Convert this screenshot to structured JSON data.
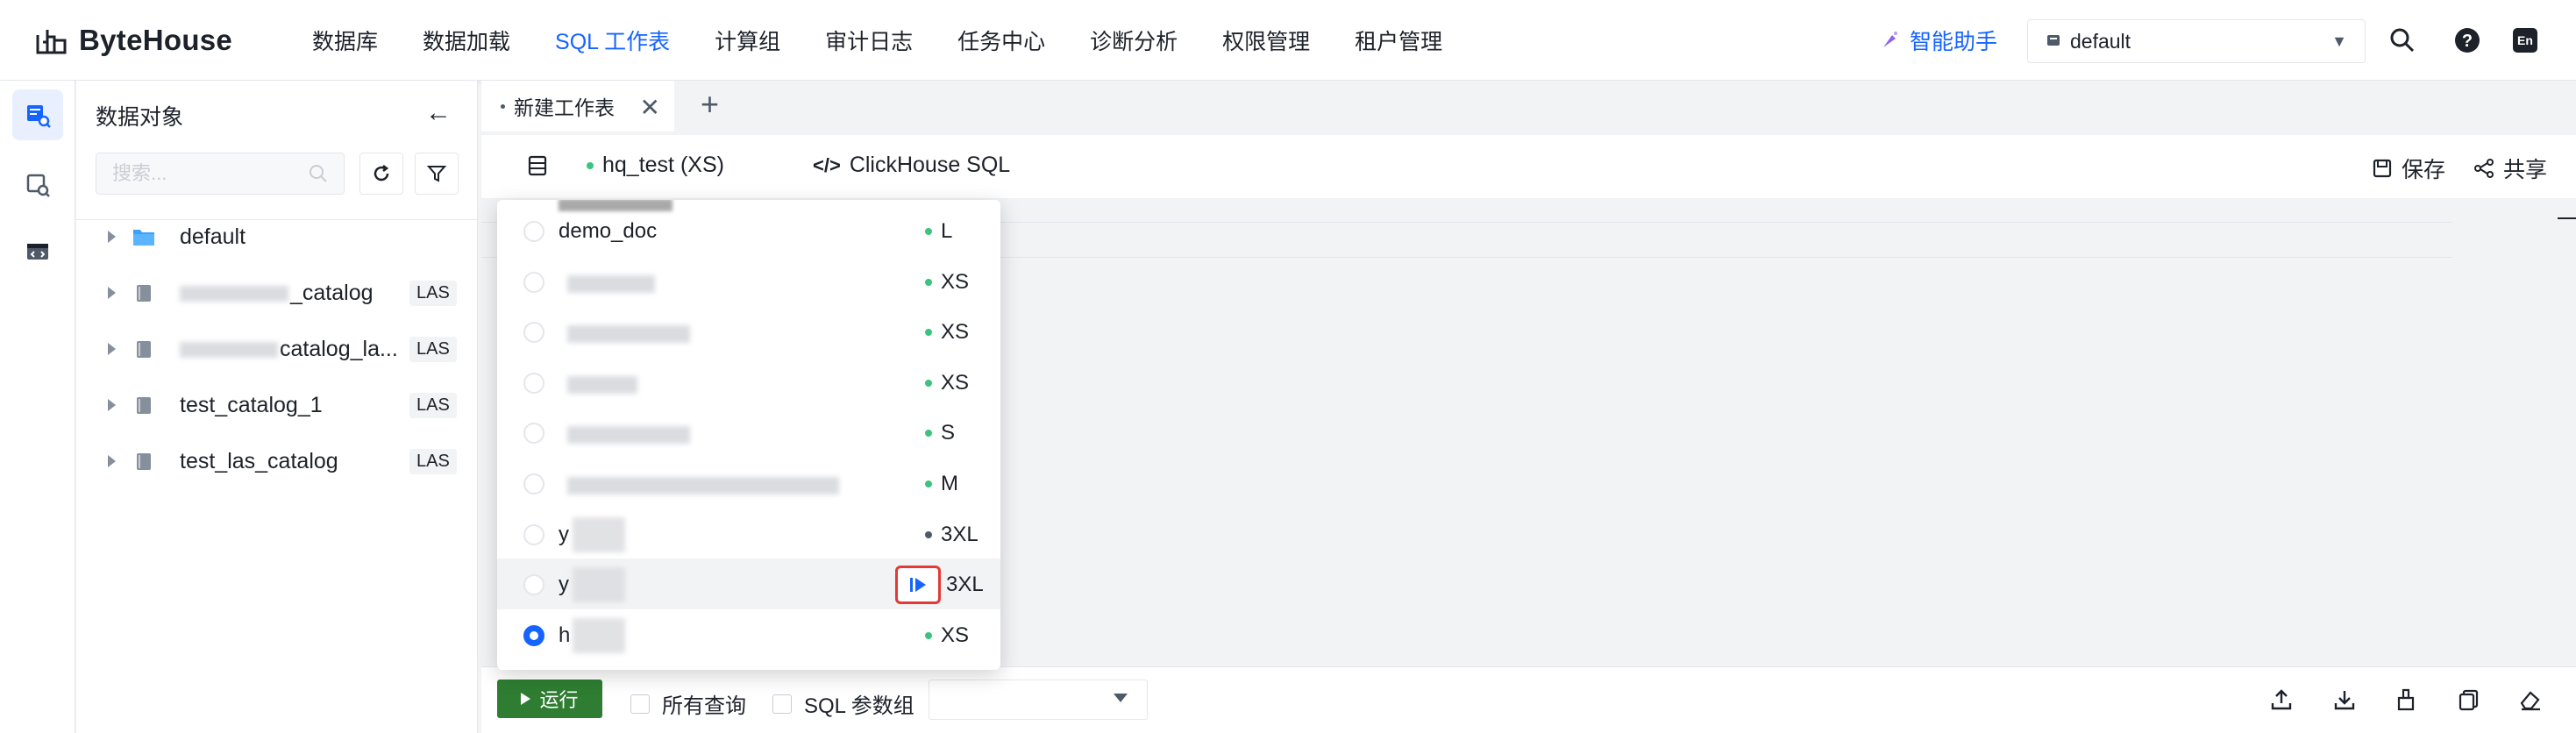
{
  "app": {
    "logo_text": "ByteHouse"
  },
  "nav": {
    "items": [
      "数据库",
      "数据加载",
      "SQL 工作表",
      "计算组",
      "审计日志",
      "任务中心",
      "诊断分析",
      "权限管理",
      "租户管理"
    ],
    "active_index": 2
  },
  "header": {
    "assistant_label": "智能助手",
    "database_select": "default",
    "lang_label": "En"
  },
  "sidebar": {
    "title": "数据对象",
    "search_placeholder": "搜索...",
    "tree": [
      {
        "label": "default",
        "kind": "folder",
        "tag": ""
      },
      {
        "label": "_catalog",
        "kind": "catalog",
        "tag": "LAS",
        "blurred_prefix": true
      },
      {
        "label": "catalog_la...",
        "kind": "catalog",
        "tag": "LAS",
        "blurred_prefix": true
      },
      {
        "label": "test_catalog_1",
        "kind": "catalog",
        "tag": "LAS"
      },
      {
        "label": "test_las_catalog",
        "kind": "catalog",
        "tag": "LAS"
      }
    ]
  },
  "tabs": {
    "items": [
      {
        "label": "新建工作表",
        "unsaved": true
      }
    ],
    "add_label": "+"
  },
  "toolbar": {
    "compute_group": "hq_test (XS)",
    "dialect": "ClickHouse SQL",
    "save_label": "保存",
    "share_label": "共享"
  },
  "compute_dropdown": {
    "rows": [
      {
        "name": "demo_doc",
        "size": "L",
        "status_color": "#3ac47d",
        "selected": false
      },
      {
        "name": "",
        "size": "XS",
        "status_color": "#3ac47d",
        "selected": false
      },
      {
        "name": "",
        "size": "XS",
        "status_color": "#3ac47d",
        "selected": false
      },
      {
        "name": "",
        "size": "XS",
        "status_color": "#3ac47d",
        "selected": false
      },
      {
        "name": "",
        "size": "S",
        "status_color": "#3ac47d",
        "selected": false
      },
      {
        "name": "",
        "size": "M",
        "status_color": "#3ac47d",
        "selected": false
      },
      {
        "name": "y",
        "size": "3XL",
        "status_color": "#4e5969",
        "selected": false
      },
      {
        "name": "y",
        "size": "3XL",
        "status_color": "",
        "selected": false,
        "hover": true,
        "start_button": true
      },
      {
        "name": "h",
        "size": "XS",
        "status_color": "#3ac47d",
        "selected": true
      }
    ]
  },
  "bottom": {
    "run_label": "运行",
    "all_queries_label": "所有查询",
    "sql_params_label": "SQL 参数组",
    "params_value": ""
  },
  "colors": {
    "accent": "#1664ff",
    "run_green": "#2e7d32",
    "status_green": "#3ac47d",
    "highlight_red": "#e53935"
  }
}
